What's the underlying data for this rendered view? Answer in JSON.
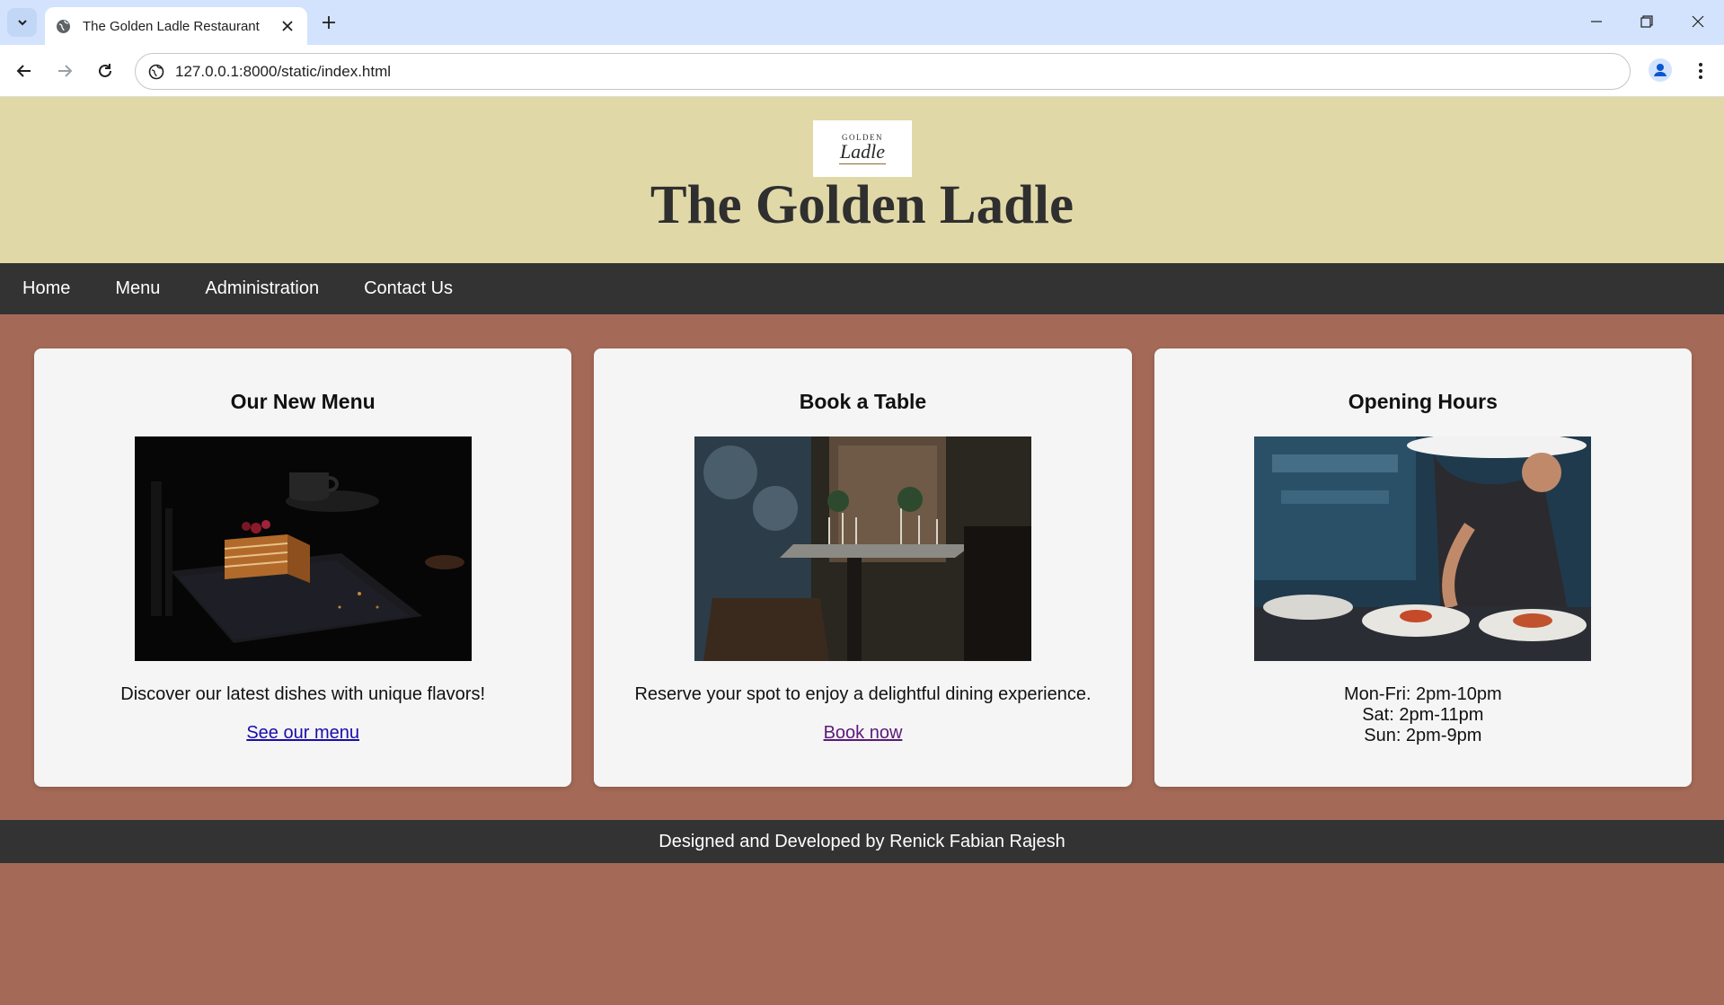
{
  "browser": {
    "tab_title": "The Golden Ladle Restaurant",
    "url": "127.0.0.1:8000/static/index.html"
  },
  "header": {
    "logo_top": "GOLDEN",
    "logo_bottom": "Ladle",
    "title": "The Golden Ladle"
  },
  "nav": {
    "items": [
      "Home",
      "Menu",
      "Administration",
      "Contact Us"
    ]
  },
  "cards": [
    {
      "title": "Our New Menu",
      "text": "Discover our latest dishes with unique flavors!",
      "link": "See our menu"
    },
    {
      "title": "Book a Table",
      "text": "Reserve your spot to enjoy a delightful dining experience.",
      "link": "Book now"
    },
    {
      "title": "Opening Hours",
      "hours": [
        "Mon-Fri: 2pm-10pm",
        "Sat: 2pm-11pm",
        "Sun: 2pm-9pm"
      ]
    }
  ],
  "footer": {
    "text": "Designed and Developed by Renick Fabian Rajesh"
  },
  "colors": {
    "header_bg": "#e1d8a8",
    "nav_bg": "#333333",
    "page_bg": "#a46a57",
    "card_bg": "#f5f5f5",
    "footer_bg": "#333333"
  }
}
